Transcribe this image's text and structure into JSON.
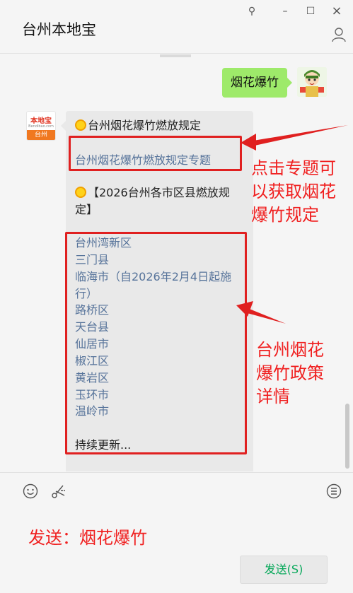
{
  "window": {
    "title": "台州本地宝",
    "controls": {
      "pin": "⚲",
      "minimize": "–",
      "maximize": "☐",
      "close": "×"
    }
  },
  "chat": {
    "my_message": "烟花爆竹",
    "bot_avatar": {
      "logo_text": "本地宝",
      "logo_sub": "Bendibao.com",
      "city": "台州"
    },
    "bot_message": {
      "heading": "台州烟花爆竹燃放规定",
      "topic_link": "台州烟花爆竹燃放规定专题",
      "section_line1": "【2026台州各市区县燃放规",
      "section_line2": "定】",
      "districts": [
        "台州湾新区",
        "三门县",
        "临海市（自2026年2月4日起施",
        "行）",
        "路桥区",
        "天台县",
        "仙居市",
        "椒江区",
        "黄岩区",
        "玉环市",
        "温岭市"
      ],
      "footer": "持续更新..."
    },
    "annotations": {
      "topic_note": [
        "点击专题可",
        "以获取烟花",
        "爆竹规定"
      ],
      "detail_note": [
        "台州烟花",
        "爆竹政策",
        "详情"
      ]
    }
  },
  "input": {
    "draft_text": "发送：烟花爆竹",
    "send_label": "发送(S)",
    "tools": [
      "emoji-icon",
      "scissors-icon",
      "history-icon"
    ]
  },
  "colors": {
    "accent_red": "#f02020",
    "bubble_green": "#9eea6a",
    "send_green": "#07a85a",
    "link": "#56739a"
  }
}
